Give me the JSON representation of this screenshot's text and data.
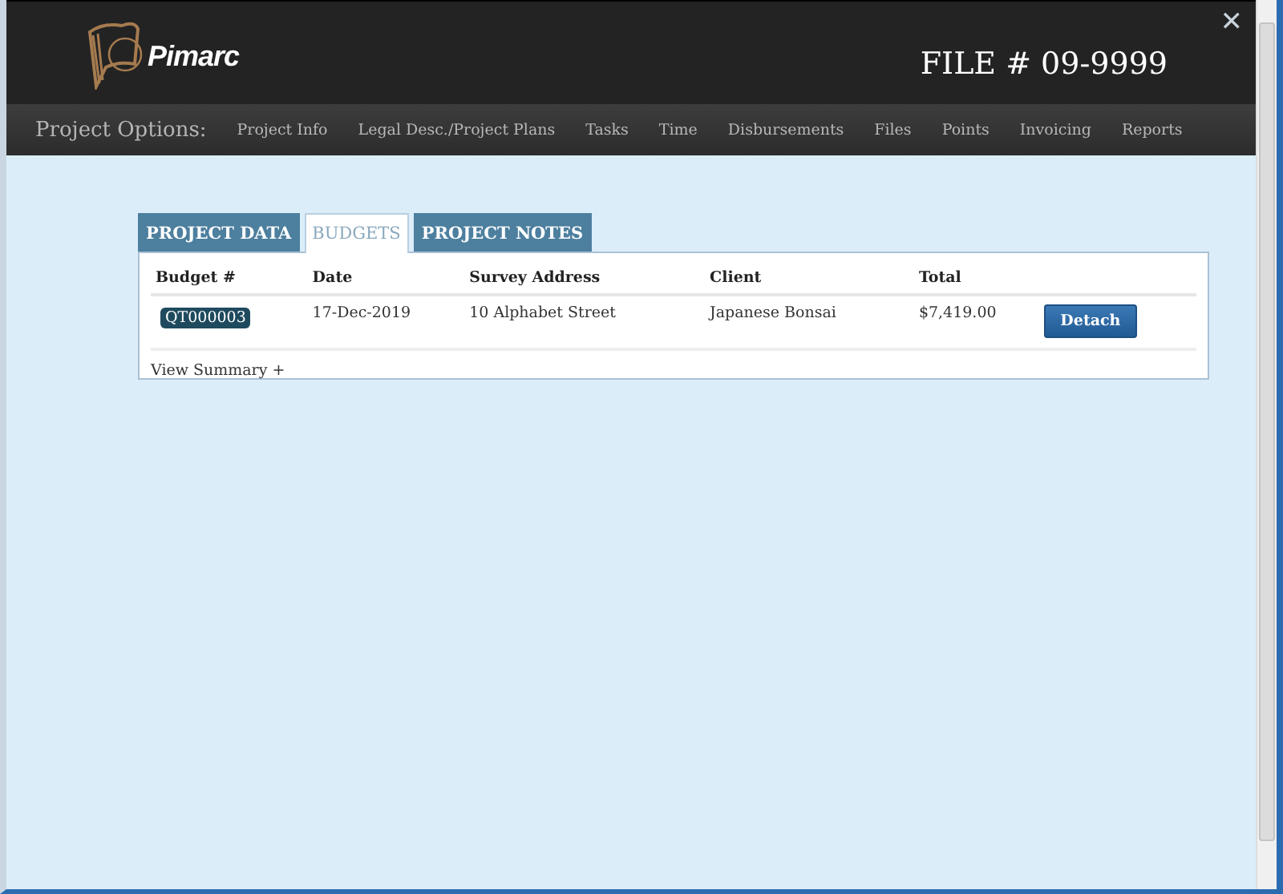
{
  "header": {
    "logo": "Pimarc",
    "file_number": "FILE # 09-9999",
    "close": "✕"
  },
  "nav": {
    "label": "Project Options:",
    "items": [
      {
        "label": "Project Info"
      },
      {
        "label": "Legal Desc./Project Plans"
      },
      {
        "label": "Tasks"
      },
      {
        "label": "Time"
      },
      {
        "label": "Disbursements"
      },
      {
        "label": "Files"
      },
      {
        "label": "Points"
      },
      {
        "label": "Invoicing"
      },
      {
        "label": "Reports"
      }
    ]
  },
  "tabs": [
    {
      "label": "PROJECT DATA",
      "selected": false
    },
    {
      "label": "BUDGETS",
      "selected": true
    },
    {
      "label": "PROJECT NOTES",
      "selected": false
    }
  ],
  "table": {
    "columns": [
      "Budget #",
      "Date",
      "Survey Address",
      "Client",
      "Total"
    ],
    "rows": [
      {
        "budget": "QT000003",
        "date": "17-Dec-2019",
        "address": "10 Alphabet Street",
        "client": "Japanese Bonsai",
        "total": "$7,419.00",
        "action": "Detach"
      }
    ]
  },
  "view_summary": "View Summary +"
}
